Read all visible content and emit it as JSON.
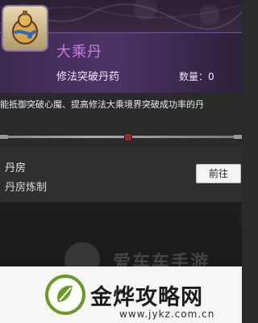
{
  "item": {
    "name": "大乘丹",
    "subtitle": "修法突破丹药",
    "quantity_text": "数量：0",
    "icon": "gourd-pill-icon"
  },
  "description": {
    "text": "能抵御突破心魔、提高修法大乘境界突破成功率的丹"
  },
  "source": {
    "title": "丹房",
    "detail": "丹房炼制",
    "goto_label": "前往"
  },
  "watermark": {
    "dim_text": "爱车车手游",
    "brand": "金烨攻略网",
    "domain": "www.jykz.com.cn"
  },
  "colors": {
    "item_name": "#c97be2",
    "panel_purple": "#4c3566",
    "watermark_green": "#6a9a22"
  }
}
